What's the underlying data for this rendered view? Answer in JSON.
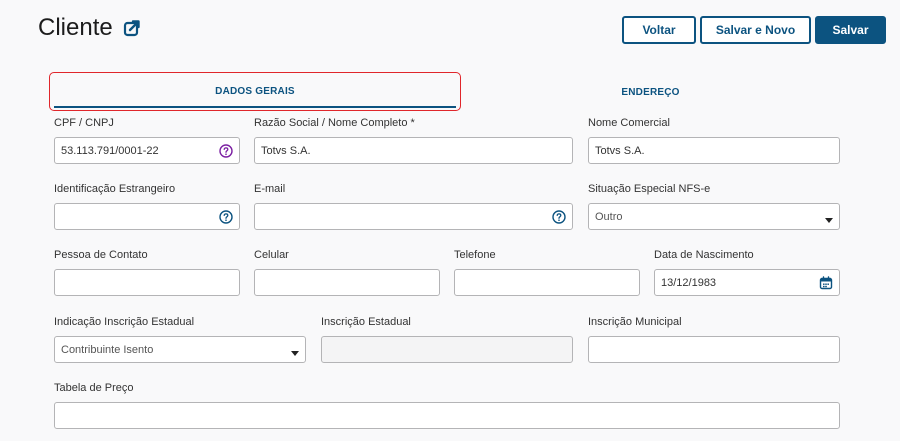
{
  "header": {
    "title": "Cliente",
    "icon": "external-link-icon"
  },
  "actions": {
    "voltar": "Voltar",
    "salvar_novo": "Salvar e Novo",
    "salvar": "Salvar"
  },
  "tabs": [
    {
      "label": "DADOS GERAIS",
      "active": true
    },
    {
      "label": "ENDEREÇO",
      "active": false
    }
  ],
  "form": {
    "cpf_cnpj": {
      "label": "CPF / CNPJ",
      "value": "53.113.791/0001-22",
      "icon": "help-circle-icon"
    },
    "razao_social": {
      "label": "Razão Social / Nome Completo *",
      "value": "Totvs S.A."
    },
    "nome_comercial": {
      "label": "Nome Comercial",
      "value": "Totvs S.A."
    },
    "id_estrangeiro": {
      "label": "Identificação Estrangeiro",
      "value": "",
      "icon": "help-circle-icon"
    },
    "email": {
      "label": "E-mail",
      "value": "",
      "icon": "help-circle-icon"
    },
    "situacao_nfse": {
      "label": "Situação Especial NFS-e",
      "value": "Outro"
    },
    "pessoa_contato": {
      "label": "Pessoa de Contato",
      "value": ""
    },
    "celular": {
      "label": "Celular",
      "value": ""
    },
    "telefone": {
      "label": "Telefone",
      "value": ""
    },
    "data_nascimento": {
      "label": "Data de Nascimento",
      "value": "13/12/1983",
      "icon": "calendar-icon"
    },
    "indicacao_ie": {
      "label": "Indicação Inscrição Estadual",
      "value": "Contribuinte Isento"
    },
    "inscricao_estadual": {
      "label": "Inscrição Estadual",
      "value": ""
    },
    "inscricao_municipal": {
      "label": "Inscrição Municipal",
      "value": ""
    },
    "tabela_preco": {
      "label": "Tabela de Preço",
      "value": ""
    }
  },
  "colors": {
    "primary": "#0c5380",
    "highlight": "#e0262b",
    "help_icon": "#7b1fa2"
  }
}
